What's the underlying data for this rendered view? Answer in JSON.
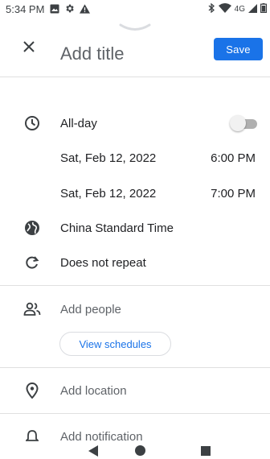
{
  "status_bar": {
    "time": "5:34 PM",
    "network": "4G"
  },
  "header": {
    "save_label": "Save",
    "title_placeholder": "Add title"
  },
  "event": {
    "all_day_label": "All-day",
    "all_day_on": false,
    "start_date": "Sat, Feb 12, 2022",
    "start_time": "6:00 PM",
    "end_date": "Sat, Feb 12, 2022",
    "end_time": "7:00 PM",
    "timezone": "China Standard Time",
    "repeat": "Does not repeat",
    "add_people": "Add people",
    "view_schedules": "View schedules",
    "add_location": "Add location",
    "add_notification": "Add notification"
  },
  "colors": {
    "accent": "#1a73e8",
    "text_primary": "#202124",
    "text_secondary": "#5f6368",
    "icon": "#3c4043"
  }
}
